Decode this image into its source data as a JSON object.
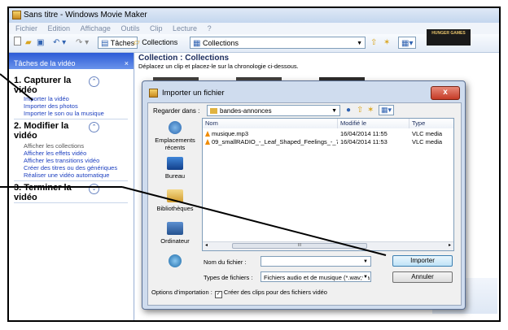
{
  "window": {
    "title": "Sans titre - Windows Movie Maker"
  },
  "menu": [
    "Fichier",
    "Edition",
    "Affichage",
    "Outils",
    "Clip",
    "Lecture",
    "?"
  ],
  "toolbar": {
    "tasks_label": "Tâches",
    "collections_label": "Collections",
    "collection_select": "Collections"
  },
  "taskpane": {
    "header": "Tâches de la vidéo",
    "close": "×",
    "sections": [
      {
        "title1": "1. Capturer la",
        "title2": "vidéo",
        "toggle": "⌃",
        "links": [
          "Importer la vidéo",
          "Importer des photos",
          "Importer le son ou la musique"
        ]
      },
      {
        "title1": "2. Modifier la",
        "title2": "vidéo",
        "toggle": "⌃",
        "links": [
          "Afficher les collections",
          "Afficher les effets vidéo",
          "Afficher les transitions vidéo",
          "Créer des titres ou des génériques",
          "Réaliser une vidéo automatique"
        ]
      },
      {
        "title1": "3. Terminer la",
        "title2": "vidéo",
        "toggle": "⌄",
        "links": []
      }
    ]
  },
  "collection": {
    "title": "Collection : Collections",
    "subtitle": "Déplacez un clip et placez-le sur la chronologie ci-dessous.",
    "thumb_text": "HUNGER GAMES"
  },
  "dialog": {
    "title": "Importer un fichier",
    "close": "x",
    "look_in_label": "Regarder dans :",
    "look_in_value": "bandes-annonces",
    "places": [
      "Emplacements récents",
      "Bureau",
      "Bibliothèques",
      "Ordinateur"
    ],
    "columns": [
      "Nom",
      "Modifié le",
      "Type"
    ],
    "files": [
      {
        "name": "musique.mp3",
        "modified": "16/04/2014 11:55",
        "type": "VLC media"
      },
      {
        "name": "09_smallRADIO_-_Leaf_Shaped_Feelings_-_7...",
        "modified": "16/04/2014 11:53",
        "type": "VLC media"
      }
    ],
    "scroll_thumb": "III",
    "filename_label": "Nom du fichier :",
    "filename_value": "",
    "filetype_label": "Types de fichiers :",
    "filetype_value": "Fichiers audio et de musique (*.wav;*.a",
    "import_button": "Importer",
    "cancel_button": "Annuler",
    "options_label": "Options d'importation :",
    "options_check": "Créer des clips pour des fichiers vidéo"
  },
  "colors": {
    "accent": "#2c5bd6",
    "link": "#1c3fbf",
    "dialog_close": "#c53a26"
  }
}
